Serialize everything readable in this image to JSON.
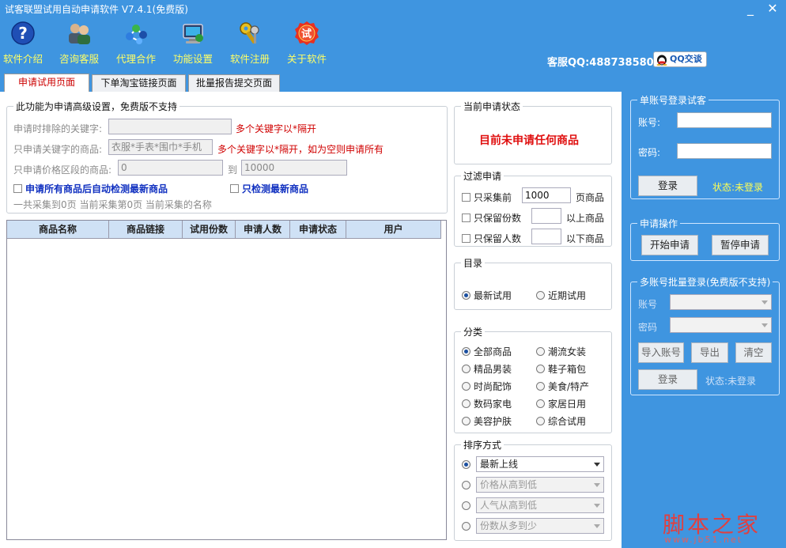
{
  "window": {
    "title": "试客联盟试用自动申请软件 V7.4.1(免费版)",
    "min_icon": "minimize-icon",
    "close_icon": "close-icon"
  },
  "toolbar": {
    "items": [
      {
        "label": "软件介绍",
        "icon": "help-question-icon"
      },
      {
        "label": "咨询客服",
        "icon": "customer-service-icon"
      },
      {
        "label": "代理合作",
        "icon": "network-molecule-icon"
      },
      {
        "label": "功能设置",
        "icon": "settings-computer-icon"
      },
      {
        "label": "软件注册",
        "icon": "register-key-icon"
      },
      {
        "label": "关于软件",
        "icon": "about-badge-icon"
      }
    ],
    "about_badge_char": "试",
    "qq_text": "客服QQ:488738580",
    "qq_button": "QQ交谈"
  },
  "tabs": [
    {
      "label": "申请试用页面",
      "active": true
    },
    {
      "label": "下单淘宝链接页面",
      "active": false
    },
    {
      "label": "批量报告提交页面",
      "active": false
    }
  ],
  "advanced": {
    "legend": "此功能为申请高级设置，免费版不支持",
    "exclude_label": "申请时排除的关键字:",
    "exclude_value": "",
    "exclude_hint": "多个关键字以*隔开",
    "only_label": "只申请关键字的商品:",
    "only_value": "衣服*手表*围巾*手机",
    "only_hint": "多个关键字以*隔开，如为空则申请所有",
    "price_label": "只申请价格区段的商品:",
    "price_from": "0",
    "price_to_label": "到",
    "price_to": "10000",
    "auto_check_label": "申请所有商品后自动检测最新商品",
    "only_new_label": "只检测最新商品",
    "collect_summary": "一共采集到0页  当前采集第0页  当前采集的名称"
  },
  "grid": {
    "columns": [
      "商品名称",
      "商品链接",
      "试用份数",
      "申请人数",
      "申请状态",
      "用户"
    ]
  },
  "status_box": {
    "legend": "当前申请状态",
    "message": "目前未申请任何商品"
  },
  "filter": {
    "legend": "过滤申请",
    "rows": [
      {
        "prefix": "只采集前",
        "value": "1000",
        "suffix": "页商品"
      },
      {
        "prefix": "只保留份数",
        "value": "",
        "suffix": "以上商品"
      },
      {
        "prefix": "只保留人数",
        "value": "",
        "suffix": "以下商品"
      }
    ]
  },
  "catalog": {
    "legend": "目录",
    "options": [
      "最新试用",
      "近期试用"
    ],
    "selected": 0
  },
  "category": {
    "legend": "分类",
    "options": [
      "全部商品",
      "潮流女装",
      "精品男装",
      "鞋子箱包",
      "时尚配饰",
      "美食/特产",
      "数码家电",
      "家居日用",
      "美容护肤",
      "综合试用"
    ],
    "selected": 0
  },
  "sort": {
    "legend": "排序方式",
    "options": [
      "最新上线",
      "价格从高到低",
      "人气从高到低",
      "份数从多到少"
    ],
    "selected": 0
  },
  "single_login": {
    "legend": "单账号登录试客",
    "account_label": "账号:",
    "password_label": "密码:",
    "login_button": "登录",
    "status": "状态:未登录"
  },
  "apply_ops": {
    "legend": "申请操作",
    "start_button": "开始申请",
    "pause_button": "暂停申请"
  },
  "multi_login": {
    "legend": "多账号批量登录(免费版不支持)",
    "account_label": "账号",
    "password_label": "密码",
    "import_button": "导入账号",
    "export_button": "导出",
    "clear_button": "清空",
    "login_button": "登录",
    "status": "状态:未登录"
  },
  "watermark": {
    "cn": "脚本之家",
    "en": "www.jb51.net"
  }
}
